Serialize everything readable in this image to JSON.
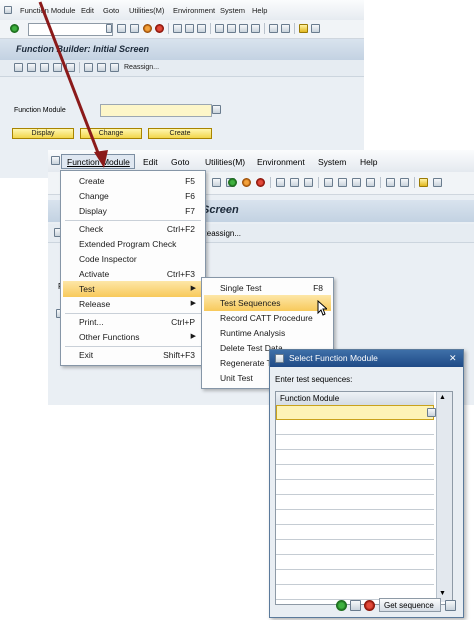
{
  "screen1": {
    "menubar": [
      "Function Module",
      "Edit",
      "Goto",
      "Utilities(M)",
      "Environment",
      "System",
      "Help"
    ],
    "title": "Function Builder: Initial Screen",
    "toolbar_link": "Reassign...",
    "field_label": "Function Module",
    "buttons": {
      "display": "Display",
      "change": "Change",
      "create": "Create"
    }
  },
  "screen2": {
    "menubar": [
      "Function Module",
      "Edit",
      "Goto",
      "Utilities(M)",
      "Environment",
      "System",
      "Help"
    ],
    "title_fragment": "Screen",
    "toolbar_link": "Reassign...",
    "field_label_fragment": "F"
  },
  "function_module_menu": [
    {
      "label": "Create",
      "shortcut": "F5"
    },
    {
      "label": "Change",
      "shortcut": "F6"
    },
    {
      "label": "Display",
      "shortcut": "F7"
    },
    {
      "label": "Check",
      "shortcut": "Ctrl+F2"
    },
    {
      "label": "Extended Program Check",
      "shortcut": ""
    },
    {
      "label": "Code Inspector",
      "shortcut": ""
    },
    {
      "label": "Activate",
      "shortcut": "Ctrl+F3"
    },
    {
      "label": "Test",
      "shortcut": ""
    },
    {
      "label": "Release",
      "shortcut": ""
    },
    {
      "label": "Print...",
      "shortcut": "Ctrl+P"
    },
    {
      "label": "Other Functions",
      "shortcut": ""
    },
    {
      "label": "Exit",
      "shortcut": "Shift+F3"
    }
  ],
  "test_submenu": [
    {
      "label": "Single Test",
      "shortcut": "F8"
    },
    {
      "label": "Test Sequences",
      "shortcut": ""
    },
    {
      "label": "Record CATT Procedure",
      "shortcut": ""
    },
    {
      "label": "Runtime Analysis",
      "shortcut": ""
    },
    {
      "label": "Delete Test Data",
      "shortcut": ""
    },
    {
      "label": "Regenerate T",
      "shortcut": ""
    },
    {
      "label": "Unit Test",
      "shortcut": ""
    }
  ],
  "dialog": {
    "title": "Select Function Module",
    "prompt": "Enter test sequences:",
    "column_header": "Function Module",
    "close_symbol": "✕",
    "get_sequence_label": "Get sequence"
  },
  "colors": {
    "highlight": "#f8c95b",
    "sap_button": "#f2d64b",
    "arrow": "#8b1a1a",
    "dialog_title": "#1f4a86"
  }
}
